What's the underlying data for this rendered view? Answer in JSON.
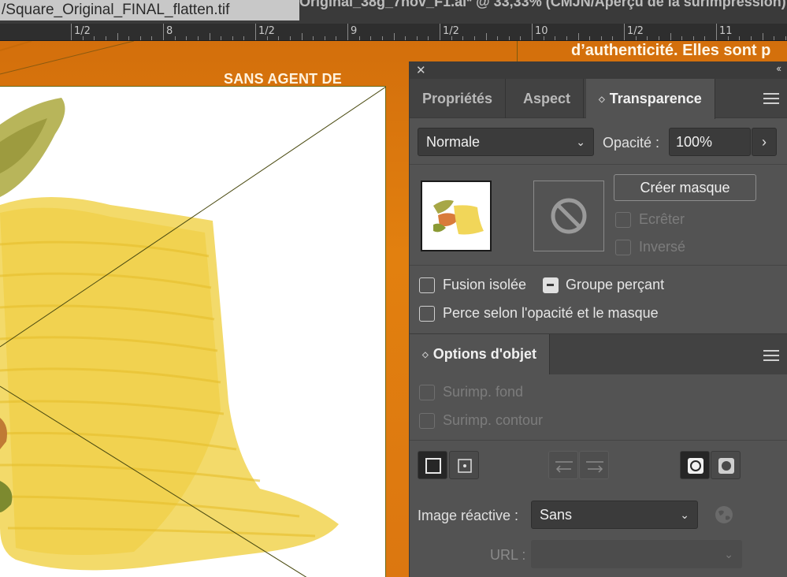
{
  "window": {
    "file_tab": "/Square_Original_FINAL_flatten.tif",
    "doc_title": "Original_38g_7nov_F1.ai* @ 33,33% (CMJN/Aperçu de la surimpression)"
  },
  "ruler": {
    "labels": [
      "1/2",
      "8",
      "1/2",
      "9",
      "1/2",
      "10",
      "1/2",
      "11"
    ]
  },
  "artboard": {
    "top_text": "d’authenticité. Elles sont p",
    "side_text": "SANS AGENT DE",
    "colors": {
      "background": "#dd7a12",
      "text": "#fff6e6"
    }
  },
  "panel": {
    "tabs": [
      "Propriétés",
      "Aspect",
      "Transparence"
    ],
    "active_tab": "Transparence",
    "blend_mode": "Normale",
    "opacity_label": "Opacité :",
    "opacity_value": "100%",
    "create_mask_label": "Créer masque",
    "clip_label": "Ecrêter",
    "invert_label": "Inversé",
    "isolate_label": "Fusion isolée",
    "knockout_label": "Groupe perçant",
    "opacity_mask_label": "Perce selon l'opacité et le masque"
  },
  "object_options": {
    "title": "Options d'objet",
    "overprint_fill": "Surimp. fond",
    "overprint_stroke": "Surimp. contour",
    "image_map_label": "Image réactive :",
    "image_map_value": "Sans",
    "url_label": "URL :",
    "url_value": ""
  }
}
